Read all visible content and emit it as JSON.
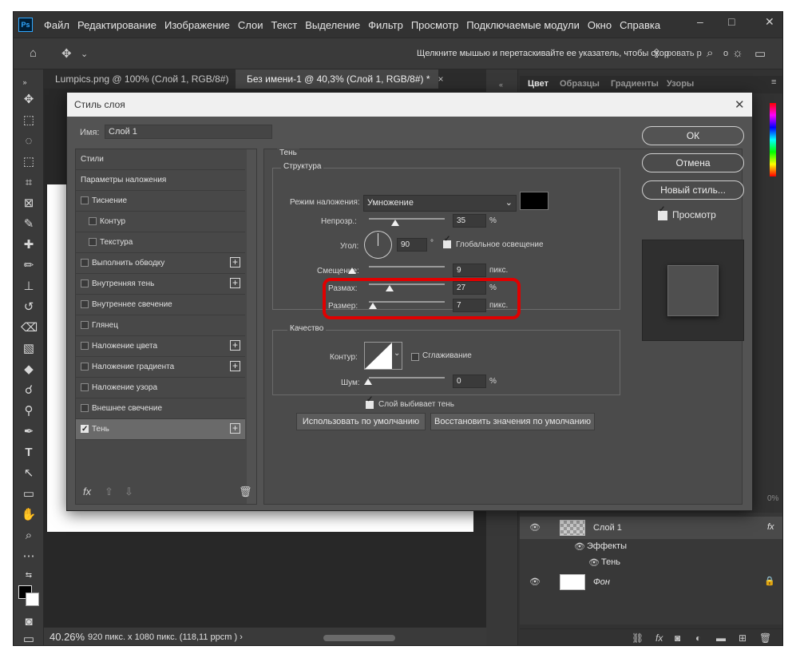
{
  "app": {
    "logo": "Ps"
  },
  "menubar": {
    "items": [
      "Файл",
      "Редактирование",
      "Изображение",
      "Слои",
      "Текст",
      "Выделение",
      "Фильтр",
      "Просмотр",
      "Подключаемые модули",
      "Окно",
      "Справка"
    ]
  },
  "options_bar": {
    "hint": "Щелкните мышью и перетаскивайте ее указатель, чтобы скор",
    "tail_a": "ровать р",
    "tail_b": "о"
  },
  "tabs": [
    {
      "label": "Lumpics.png @ 100% (Слой 1, RGB/8#)",
      "close": "×"
    },
    {
      "label": "Без имени-1 @ 40,3% (Слой 1, RGB/8#) *",
      "close": "×"
    }
  ],
  "status": {
    "zoom": "40.26%",
    "info": "920 пикс. x 1080 пикс. (118,11 ppcm )",
    "arrow": "›"
  },
  "panels": {
    "color_tabs": [
      "Цвет",
      "Образцы",
      "Градиенты",
      "Узоры"
    ],
    "layers": [
      {
        "name": "Слой 1",
        "fx": "fx"
      },
      {
        "name": "Эффекты"
      },
      {
        "name": "Тень"
      },
      {
        "name": "Фон"
      }
    ],
    "percent_a": "0%",
    "percent_b": "0%"
  },
  "dialog": {
    "title": "Стиль слоя",
    "name_label": "Имя:",
    "name_value": "Слой 1",
    "styles": [
      {
        "label": "Стили",
        "checkbox": false,
        "plus": false,
        "indent": 0
      },
      {
        "label": "Параметры наложения",
        "checkbox": false,
        "plus": false,
        "indent": 0
      },
      {
        "label": "Тиснение",
        "checkbox": true,
        "checked": false,
        "plus": false,
        "indent": 0
      },
      {
        "label": "Контур",
        "checkbox": true,
        "checked": false,
        "plus": false,
        "indent": 1
      },
      {
        "label": "Текстура",
        "checkbox": true,
        "checked": false,
        "plus": false,
        "indent": 1
      },
      {
        "label": "Выполнить обводку",
        "checkbox": true,
        "checked": false,
        "plus": true,
        "indent": 0
      },
      {
        "label": "Внутренняя тень",
        "checkbox": true,
        "checked": false,
        "plus": true,
        "indent": 0
      },
      {
        "label": "Внутреннее свечение",
        "checkbox": true,
        "checked": false,
        "plus": false,
        "indent": 0
      },
      {
        "label": "Глянец",
        "checkbox": true,
        "checked": false,
        "plus": false,
        "indent": 0
      },
      {
        "label": "Наложение цвета",
        "checkbox": true,
        "checked": false,
        "plus": true,
        "indent": 0
      },
      {
        "label": "Наложение градиента",
        "checkbox": true,
        "checked": false,
        "plus": true,
        "indent": 0
      },
      {
        "label": "Наложение узора",
        "checkbox": true,
        "checked": false,
        "plus": false,
        "indent": 0
      },
      {
        "label": "Внешнее свечение",
        "checkbox": true,
        "checked": false,
        "plus": false,
        "indent": 0
      },
      {
        "label": "Тень",
        "checkbox": true,
        "checked": true,
        "plus": true,
        "indent": 0,
        "selected": true
      }
    ],
    "footer_fx": "fx",
    "section_title": "Тень",
    "structure": {
      "legend": "Структура",
      "blend_label": "Режим наложения:",
      "blend_value": "Умножение",
      "blend_color": "#000000",
      "opacity_label": "Непрозр.:",
      "opacity_value": "35",
      "opacity_unit": "%",
      "opacity_level": 0.35,
      "angle_label": "Угол:",
      "angle_value": "90",
      "angle_unit": "°",
      "global_light_label": "Глобальное освещение",
      "global_light_checked": true,
      "distance_label": "Смещение:",
      "distance_value": "9",
      "distance_unit": "пикс.",
      "spread_label": "Размах:",
      "spread_value": "27",
      "spread_unit": "%",
      "spread_level": 0.27,
      "size_label": "Размер:",
      "size_value": "7",
      "size_unit": "пикс."
    },
    "quality": {
      "legend": "Качество",
      "contour_label": "Контур:",
      "antialias_label": "Сглаживание",
      "noise_label": "Шум:",
      "noise_value": "0",
      "noise_unit": "%"
    },
    "knockout_label": "Слой выбивает тень",
    "btn_default": "Использовать по умолчанию",
    "btn_reset": "Восстановить значения по умолчанию",
    "ok": "ОК",
    "cancel": "Отмена",
    "new_style": "Новый стиль...",
    "preview_label": "Просмотр",
    "highlight_color": "#e00000"
  }
}
